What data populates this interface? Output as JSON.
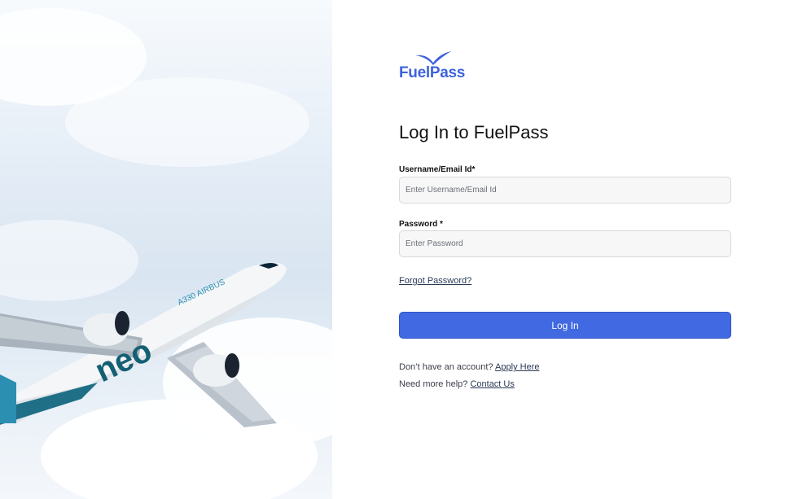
{
  "brand": {
    "name": "FuelPass",
    "color": "#3e63dd"
  },
  "form": {
    "title": "Log In to FuelPass",
    "username_label": "Username/Email Id*",
    "username_placeholder": "Enter Username/Email Id",
    "password_label": "Password *",
    "password_placeholder": "Enter Password",
    "forgot_label": "Forgot Password?",
    "login_label": "Log In"
  },
  "footer": {
    "apply_prompt": "Don’t have an account?",
    "apply_link": "Apply Here",
    "help_prompt": "Need more help?",
    "contact_link": "Contact Us"
  },
  "hero": {
    "aircraft_text": "A330 AIRBUS",
    "aircraft_mark": "neo"
  },
  "colors": {
    "primary": "#4169e1",
    "sky": "#dbe6f2"
  }
}
